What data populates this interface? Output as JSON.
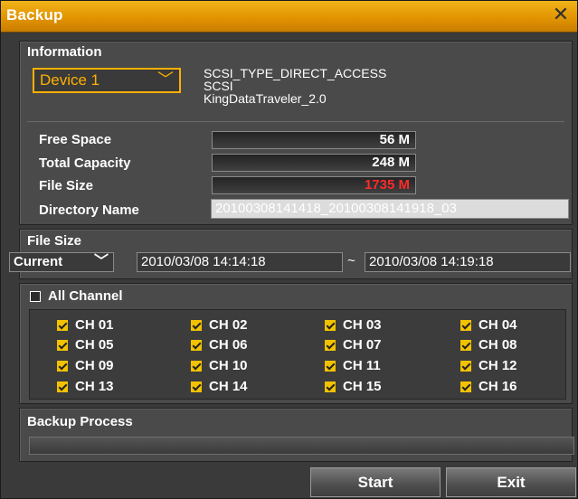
{
  "window": {
    "title": "Backup",
    "close_glyph": "✕"
  },
  "information": {
    "section_title": "Information",
    "device_select": {
      "value": "Device 1",
      "chevron": "﹀"
    },
    "device_details": [
      "SCSI_TYPE_DIRECT_ACCESS",
      "SCSI",
      "KingDataTraveler_2.0"
    ],
    "fields": {
      "free_space": {
        "label": "Free Space",
        "value": "56 M"
      },
      "total_capacity": {
        "label": "Total Capacity",
        "value": "248 M"
      },
      "file_size": {
        "label": "File Size",
        "value": "1735 M",
        "color": "#ff2a2a"
      },
      "directory_name": {
        "label": "Directory Name",
        "value": "20100308141418_20100308141918_03"
      }
    }
  },
  "file_size_section": {
    "section_title": "File Size",
    "mode_select": {
      "value": "Current",
      "chevron": "﹀"
    },
    "start": "2010/03/08  14:14:18",
    "separator": "~",
    "end": "2010/03/08  14:19:18"
  },
  "channels": {
    "all_label": "All Channel",
    "all_checked": false,
    "items": [
      {
        "label": "CH 01",
        "checked": true
      },
      {
        "label": "CH 02",
        "checked": true
      },
      {
        "label": "CH 03",
        "checked": true
      },
      {
        "label": "CH 04",
        "checked": true
      },
      {
        "label": "CH 05",
        "checked": true
      },
      {
        "label": "CH 06",
        "checked": true
      },
      {
        "label": "CH 07",
        "checked": true
      },
      {
        "label": "CH 08",
        "checked": true
      },
      {
        "label": "CH 09",
        "checked": true
      },
      {
        "label": "CH 10",
        "checked": true
      },
      {
        "label": "CH 11",
        "checked": true
      },
      {
        "label": "CH 12",
        "checked": true
      },
      {
        "label": "CH 13",
        "checked": true
      },
      {
        "label": "CH 14",
        "checked": true
      },
      {
        "label": "CH 15",
        "checked": true
      },
      {
        "label": "CH 16",
        "checked": true
      }
    ]
  },
  "backup_process": {
    "section_title": "Backup Process",
    "progress": 0
  },
  "buttons": {
    "start": "Start",
    "exit": "Exit"
  },
  "colors": {
    "title_bar": "#e29400",
    "accent": "#ffb000",
    "checkbox": "#f2c200"
  }
}
